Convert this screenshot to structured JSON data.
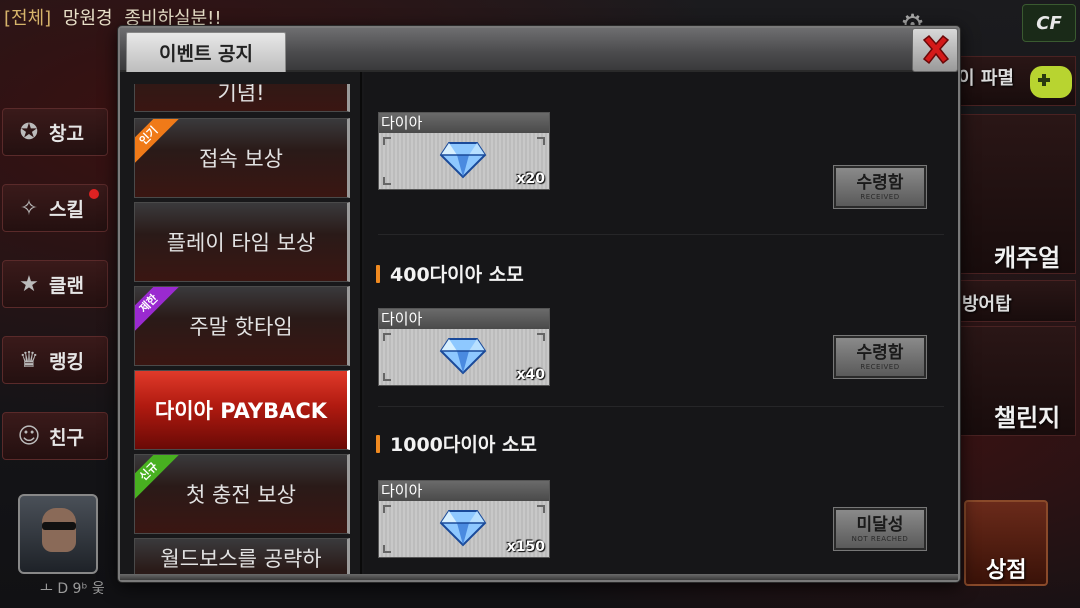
{
  "chat": {
    "channel": "[전체]",
    "name": "망원경",
    "message": "종비하실분!!"
  },
  "left_menu": {
    "items": [
      {
        "label": "창고",
        "icon": "warehouse-icon"
      },
      {
        "label": "스킬",
        "icon": "skill-icon"
      },
      {
        "label": "클랜",
        "icon": "clan-icon"
      },
      {
        "label": "랭킹",
        "icon": "ranking-icon"
      },
      {
        "label": "친구",
        "icon": "friends-icon"
      }
    ],
    "profile_status": "ㅗ D 9ᵇ 웆"
  },
  "right_menu": {
    "party_label": "이 파멸",
    "casual_label": "캐주얼",
    "defense_label": "방어탑",
    "challenge_label": "챌린지",
    "shop_label": "상점"
  },
  "modal": {
    "tab_title": "이벤트 공지",
    "nav": [
      {
        "label": "기념!",
        "badge": "",
        "state": "partial"
      },
      {
        "label": "접속 보상",
        "badge": "인기",
        "badge_type": "hot"
      },
      {
        "label": "플레이 타임 보상",
        "badge": ""
      },
      {
        "label": "주말 핫타임",
        "badge": "제한",
        "badge_type": "limited"
      },
      {
        "label": "다이아 PAYBACK",
        "badge": "",
        "state": "active"
      },
      {
        "label": "첫 충전 보상",
        "badge": "신규",
        "badge_type": "new"
      },
      {
        "label": "월드보스를 공략하",
        "badge": "",
        "state": "partial"
      }
    ],
    "rewards": [
      {
        "section": "",
        "item_label": "다이아",
        "quantity": "x20",
        "status_main": "수령함",
        "status_sub": "RECEIVED"
      },
      {
        "section": "400다이아 소모",
        "item_label": "다이아",
        "quantity": "x40",
        "status_main": "수령함",
        "status_sub": "RECEIVED"
      },
      {
        "section": "1000다이아 소모",
        "item_label": "다이아",
        "quantity": "x150",
        "status_main": "미달성",
        "status_sub": "NOT REACHED"
      }
    ]
  },
  "colors": {
    "active_tab": "#c41e12",
    "accent_orange": "#f08a20",
    "badge_hot": "#f07a18",
    "badge_limited": "#9a2ad0",
    "badge_new": "#48b020",
    "close_x": "#d41a1a"
  }
}
